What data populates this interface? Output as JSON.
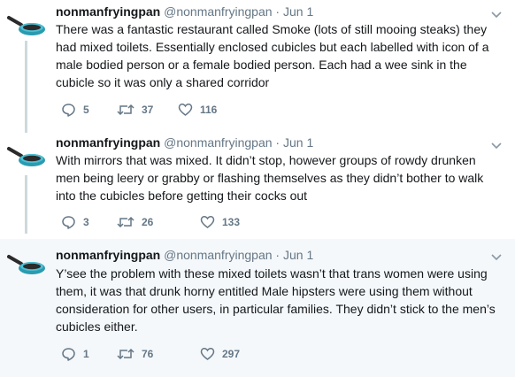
{
  "tweets": [
    {
      "name": "nonmanfryingpan",
      "handle": "@nonmanfryingpan",
      "separator": "·",
      "date": "Jun 1",
      "text": "There was a fantastic restaurant called Smoke (lots of still mooing steaks) they had mixed toilets. Essentially enclosed cubicles but each labelled with icon of a male bodied person or a female bodied person. Each had a wee sink in the cubicle so it was only a shared corridor",
      "replies": "5",
      "retweets": "37",
      "likes": "116"
    },
    {
      "name": "nonmanfryingpan",
      "handle": "@nonmanfryingpan",
      "separator": "·",
      "date": "Jun 1",
      "text": "With mirrors that was mixed. It didn’t stop, however groups of rowdy drunken men being leery or grabby or flashing themselves as they didn’t bother to walk into the cubicles before getting their cocks out",
      "replies": "3",
      "retweets": "26",
      "likes": "133"
    },
    {
      "name": "nonmanfryingpan",
      "handle": "@nonmanfryingpan",
      "separator": "·",
      "date": "Jun 1",
      "text": "Y’see the problem with these mixed toilets wasn’t that trans women were using them, it was that drunk horny entitled Male hipsters were using them without consideration for other users, in particular families. They didn’t stick to the men’s cubicles either.",
      "replies": "1",
      "retweets": "76",
      "likes": "297"
    }
  ],
  "icons": {
    "avatar": "frying-pan-icon",
    "reply": "reply-icon",
    "retweet": "retweet-icon",
    "like": "heart-icon",
    "menu": "chevron-down-icon"
  },
  "colors": {
    "pan_body": "#2a9bb0",
    "pan_handle": "#2b2b2b",
    "muted": "#657786",
    "thread_line": "#cfd9de",
    "highlight_bg": "#f5f8fa"
  }
}
